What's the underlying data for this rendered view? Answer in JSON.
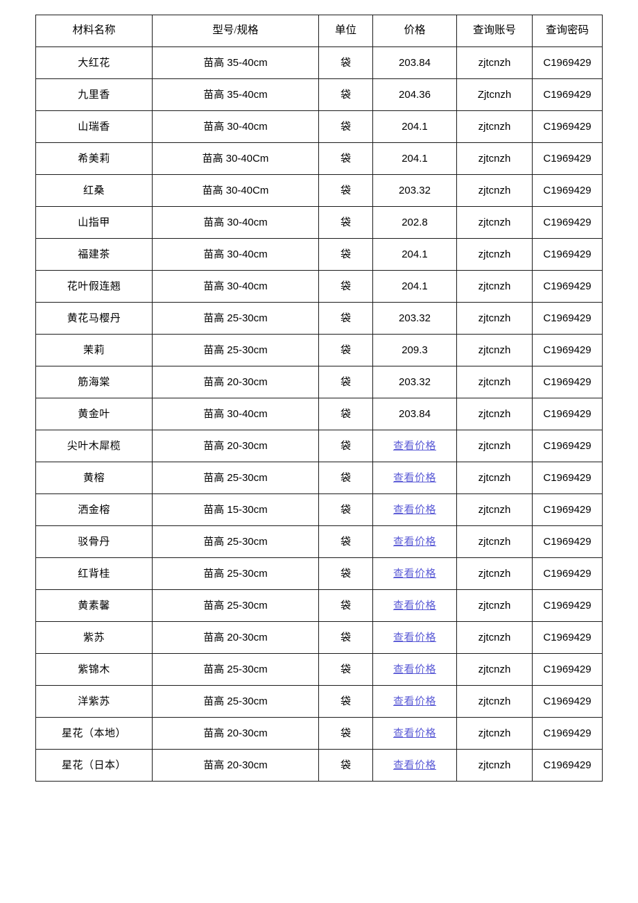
{
  "table": {
    "headers": [
      "材料名称",
      "型号/规格",
      "单位",
      "价格",
      "查询账号",
      "查询密码"
    ],
    "link_label": "查看价格",
    "link_color": "#5b5bd6",
    "border_color": "#1a1a1a",
    "rows": [
      {
        "name": "大红花",
        "spec": "苗高 35-40cm",
        "unit": "袋",
        "price": "203.84",
        "price_is_link": false,
        "account": "zjtcnzh",
        "password": "C1969429"
      },
      {
        "name": "九里香",
        "spec": "苗高 35-40cm",
        "unit": "袋",
        "price": "204.36",
        "price_is_link": false,
        "account": "Zjtcnzh",
        "password": "C1969429"
      },
      {
        "name": "山瑞香",
        "spec": "苗高 30-40cm",
        "unit": "袋",
        "price": "204.1",
        "price_is_link": false,
        "account": "zjtcnzh",
        "password": "C1969429"
      },
      {
        "name": "希美莉",
        "spec": "苗高 30-40Cm",
        "unit": "袋",
        "price": "204.1",
        "price_is_link": false,
        "account": "zjtcnzh",
        "password": "C1969429"
      },
      {
        "name": "红桑",
        "spec": "苗高 30-40Cm",
        "unit": "袋",
        "price": "203.32",
        "price_is_link": false,
        "account": "zjtcnzh",
        "password": "C1969429"
      },
      {
        "name": "山指甲",
        "spec": "苗高 30-40cm",
        "unit": "袋",
        "price": "202.8",
        "price_is_link": false,
        "account": "zjtcnzh",
        "password": "C1969429"
      },
      {
        "name": "福建茶",
        "spec": "苗高 30-40cm",
        "unit": "袋",
        "price": "204.1",
        "price_is_link": false,
        "account": "zjtcnzh",
        "password": "C1969429"
      },
      {
        "name": "花叶假连翘",
        "spec": "苗高 30-40cm",
        "unit": "袋",
        "price": "204.1",
        "price_is_link": false,
        "account": "zjtcnzh",
        "password": "C1969429"
      },
      {
        "name": "黄花马樱丹",
        "spec": "苗高 25-30cm",
        "unit": "袋",
        "price": "203.32",
        "price_is_link": false,
        "account": "zjtcnzh",
        "password": "C1969429"
      },
      {
        "name": "茉莉",
        "spec": "苗高 25-30cm",
        "unit": "袋",
        "price": "209.3",
        "price_is_link": false,
        "account": "zjtcnzh",
        "password": "C1969429"
      },
      {
        "name": "筋海棠",
        "spec": "苗高 20-30cm",
        "unit": "袋",
        "price": "203.32",
        "price_is_link": false,
        "account": "zjtcnzh",
        "password": "C1969429"
      },
      {
        "name": "黄金叶",
        "spec": "苗高 30-40cm",
        "unit": "袋",
        "price": "203.84",
        "price_is_link": false,
        "account": "zjtcnzh",
        "password": "C1969429"
      },
      {
        "name": "尖叶木犀榄",
        "spec": "苗高 20-30cm",
        "unit": "袋",
        "price": "查看价格",
        "price_is_link": true,
        "account": "zjtcnzh",
        "password": "C1969429"
      },
      {
        "name": "黄榕",
        "spec": "苗高 25-30cm",
        "unit": "袋",
        "price": "查看价格",
        "price_is_link": true,
        "account": "zjtcnzh",
        "password": "C1969429"
      },
      {
        "name": "洒金榕",
        "spec": "苗高 15-30cm",
        "unit": "袋",
        "price": "查看价格",
        "price_is_link": true,
        "account": "zjtcnzh",
        "password": "C1969429"
      },
      {
        "name": "驳骨丹",
        "spec": "苗高 25-30cm",
        "unit": "袋",
        "price": "查看价格",
        "price_is_link": true,
        "account": "zjtcnzh",
        "password": "C1969429"
      },
      {
        "name": "红背桂",
        "spec": "苗高 25-30cm",
        "unit": "袋",
        "price": "查看价格",
        "price_is_link": true,
        "account": "zjtcnzh",
        "password": "C1969429"
      },
      {
        "name": "黄素馨",
        "spec": "苗高 25-30cm",
        "unit": "袋",
        "price": "查看价格",
        "price_is_link": true,
        "account": "zjtcnzh",
        "password": "C1969429"
      },
      {
        "name": "紫苏",
        "spec": "苗高 20-30cm",
        "unit": "袋",
        "price": "查看价格",
        "price_is_link": true,
        "account": "zjtcnzh",
        "password": "C1969429"
      },
      {
        "name": "紫锦木",
        "spec": "苗高 25-30cm",
        "unit": "袋",
        "price": "查看价格",
        "price_is_link": true,
        "account": "zjtcnzh",
        "password": "C1969429"
      },
      {
        "name": "洋紫苏",
        "spec": "苗高 25-30cm",
        "unit": "袋",
        "price": "查看价格",
        "price_is_link": true,
        "account": "zjtcnzh",
        "password": "C1969429"
      },
      {
        "name": "星花（本地）",
        "spec": "苗高 20-30cm",
        "unit": "袋",
        "price": "查看价格",
        "price_is_link": true,
        "account": "zjtcnzh",
        "password": "C1969429"
      },
      {
        "name": "星花（日本）",
        "spec": "苗高 20-30cm",
        "unit": "袋",
        "price": "查看价格",
        "price_is_link": true,
        "account": "zjtcnzh",
        "password": "C1969429"
      }
    ]
  }
}
